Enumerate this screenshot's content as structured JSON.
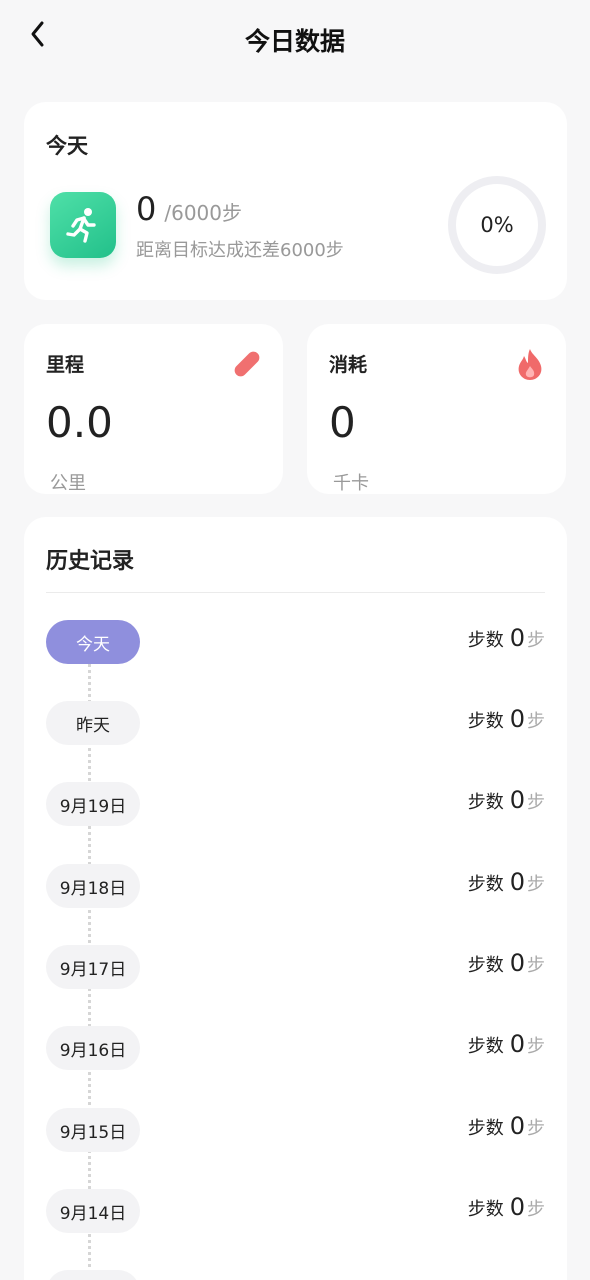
{
  "header": {
    "title": "今日数据"
  },
  "today": {
    "label": "今天",
    "steps": "0",
    "goal": "/6000步",
    "remaining": "距离目标达成还差6000步",
    "progress_text": "0%",
    "progress": 0
  },
  "distance": {
    "label": "里程",
    "value": "0.0",
    "unit": "公里"
  },
  "calories": {
    "label": "消耗",
    "value": "0",
    "unit": "千卡"
  },
  "history": {
    "title": "历史记录",
    "steps_label": "步数",
    "unit": "步",
    "rows": [
      {
        "date": "今天",
        "steps": "0"
      },
      {
        "date": "昨天",
        "steps": "0"
      },
      {
        "date": "9月19日",
        "steps": "0"
      },
      {
        "date": "9月18日",
        "steps": "0"
      },
      {
        "date": "9月17日",
        "steps": "0"
      },
      {
        "date": "9月16日",
        "steps": "0"
      },
      {
        "date": "9月15日",
        "steps": "0"
      },
      {
        "date": "9月14日",
        "steps": "0"
      },
      {
        "date": "",
        "steps": ""
      }
    ]
  },
  "colors": {
    "accent_active": "#8f8fdd",
    "run_tile": "#2fcf94",
    "distance_icon": "#f07070",
    "calorie_icon": "#f06a6a"
  }
}
